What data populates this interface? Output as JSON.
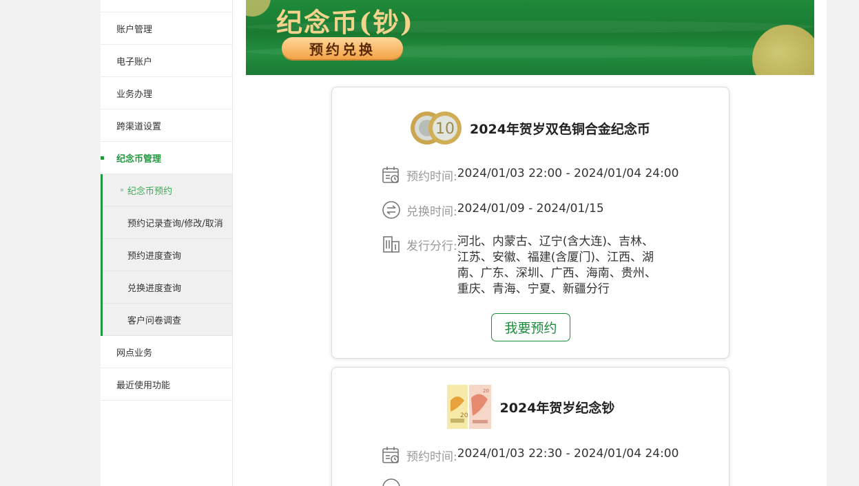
{
  "sidebar": {
    "items": [
      {
        "label": "账户管理"
      },
      {
        "label": "电子账户"
      },
      {
        "label": "业务办理"
      },
      {
        "label": "跨渠道设置"
      },
      {
        "label": "纪念币管理"
      },
      {
        "label": "网点业务"
      },
      {
        "label": "最近使用功能"
      }
    ],
    "sub_items": [
      {
        "label": "纪念币预约"
      },
      {
        "label": "预约记录查询/修改/取消"
      },
      {
        "label": "预约进度查询"
      },
      {
        "label": "兑换进度查询"
      },
      {
        "label": "客户问卷调查"
      }
    ]
  },
  "banner": {
    "title": "纪念币(钞)",
    "badge": "预约兑换"
  },
  "cards": [
    {
      "title": "2024年贺岁双色铜合金纪念币",
      "reserve_label": "预约时间:",
      "reserve_value": "2024/01/03 22:00 - 2024/01/04 24:00",
      "exchange_label": "兑换时间:",
      "exchange_value": "2024/01/09 - 2024/01/15",
      "branch_label": "发行分行:",
      "branch_value": "河北、内蒙古、辽宁(含大连)、吉林、江苏、安徽、福建(含厦门)、江西、湖南、广东、深圳、广西、海南、贵州、重庆、青海、宁夏、新疆分行",
      "button": "我要预约"
    },
    {
      "title": "2024年贺岁纪念钞",
      "reserve_label": "预约时间:",
      "reserve_value": "2024/01/03 22:30 - 2024/01/04 24:00"
    }
  ],
  "colors": {
    "accent": "#1e9a3c",
    "banner_green": "#1f8a3a",
    "badge_orange": "#f3a346",
    "title_gold": "#f4d48c"
  }
}
